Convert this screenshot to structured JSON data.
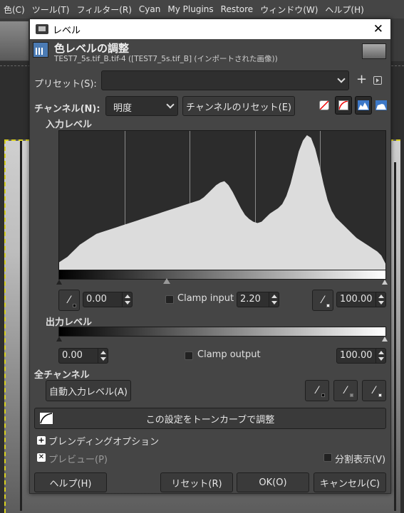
{
  "menubar": {
    "items": [
      "色(C)",
      "ツール(T)",
      "フィルター(R)",
      "Cyan",
      "My Plugins",
      "Restore",
      "ウィンドウ(W)",
      "ヘルプ(H)"
    ]
  },
  "dialog": {
    "title": "レベル",
    "header_title": "色レベルの調整",
    "header_subtitle": "TEST7_5s.tif_B.tif-4 ([TEST7_5s.tif_B] (インポートされた画像))",
    "preset_label": "プリセット(S):",
    "preset_value": "",
    "channel_label": "チャンネル(N):",
    "channel_value": "明度",
    "channel_reset": "チャンネルのリセット(E)",
    "input_levels_label": "入力レベル",
    "input_low": "0.00",
    "clamp_input_label": "Clamp input",
    "gamma": "2.20",
    "input_high": "100.00",
    "output_levels_label": "出力レベル",
    "output_low": "0.00",
    "clamp_output_label": "Clamp output",
    "output_high": "100.00",
    "all_channels_label": "全チャンネル",
    "auto_input": "自動入力レベル(A)",
    "tone_curve": "この設定をトーンカーブで調整",
    "blending_options": "ブレンディングオプション",
    "preview": "プレビュー(P)",
    "split_view": "分割表示(V)",
    "help": "ヘルプ(H)",
    "reset": "リセット(R)",
    "ok": "OK(O)",
    "cancel": "キャンセル(C)"
  },
  "histogram": {
    "shape": [
      0.06,
      0.08,
      0.1,
      0.13,
      0.16,
      0.19,
      0.21,
      0.23,
      0.25,
      0.27,
      0.28,
      0.29,
      0.3,
      0.31,
      0.32,
      0.33,
      0.34,
      0.35,
      0.36,
      0.37,
      0.38,
      0.39,
      0.4,
      0.41,
      0.42,
      0.43,
      0.44,
      0.45,
      0.46,
      0.47,
      0.48,
      0.49,
      0.5,
      0.51,
      0.52,
      0.54,
      0.57,
      0.6,
      0.63,
      0.65,
      0.66,
      0.63,
      0.58,
      0.52,
      0.46,
      0.41,
      0.38,
      0.36,
      0.35,
      0.36,
      0.39,
      0.42,
      0.44,
      0.46,
      0.49,
      0.55,
      0.64,
      0.76,
      0.88,
      0.96,
      1.0,
      0.98,
      0.9,
      0.78,
      0.64,
      0.52,
      0.44,
      0.39,
      0.36,
      0.33,
      0.3,
      0.27,
      0.24,
      0.22,
      0.2,
      0.18,
      0.16,
      0.14,
      0.11,
      0.05
    ],
    "grid": true,
    "colors": {
      "fill": "#dcdcdc",
      "bg": "#2c2c2c",
      "grid": "#8a8a8a"
    }
  }
}
